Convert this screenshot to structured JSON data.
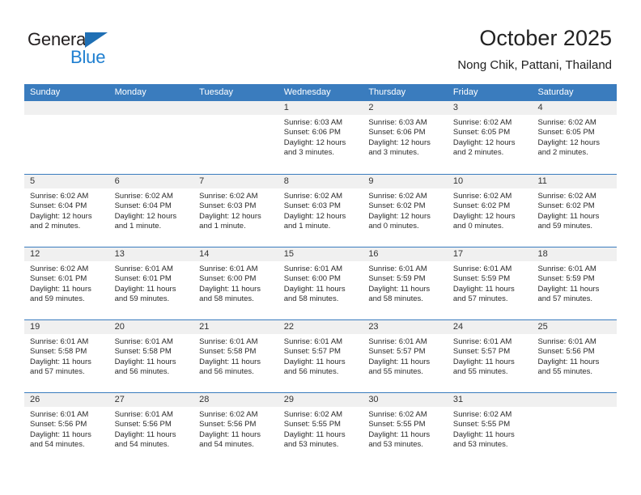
{
  "brand": {
    "name_part1": "General",
    "name_part2": "Blue",
    "triangle_color": "#1f6fb4",
    "blue_color": "#1f7fd0"
  },
  "header": {
    "title": "October 2025",
    "subtitle": "Nong Chik, Pattani, Thailand"
  },
  "theme": {
    "header_row_bg": "#3a7cbe",
    "header_row_text": "#ffffff",
    "daynum_bg": "#f0f0f0",
    "cell_bg": "#ffffff",
    "grid_line": "#3a7cbe"
  },
  "weekdays": [
    "Sunday",
    "Monday",
    "Tuesday",
    "Wednesday",
    "Thursday",
    "Friday",
    "Saturday"
  ],
  "labels": {
    "sunrise": "Sunrise:",
    "sunset": "Sunset:",
    "daylight": "Daylight:"
  },
  "weeks": [
    [
      {
        "day": "",
        "empty": true
      },
      {
        "day": "",
        "empty": true
      },
      {
        "day": "",
        "empty": true
      },
      {
        "day": "1",
        "sunrise": "Sunrise: 6:03 AM",
        "sunset": "Sunset: 6:06 PM",
        "daylight1": "Daylight: 12 hours",
        "daylight2": "and 3 minutes."
      },
      {
        "day": "2",
        "sunrise": "Sunrise: 6:03 AM",
        "sunset": "Sunset: 6:06 PM",
        "daylight1": "Daylight: 12 hours",
        "daylight2": "and 3 minutes."
      },
      {
        "day": "3",
        "sunrise": "Sunrise: 6:02 AM",
        "sunset": "Sunset: 6:05 PM",
        "daylight1": "Daylight: 12 hours",
        "daylight2": "and 2 minutes."
      },
      {
        "day": "4",
        "sunrise": "Sunrise: 6:02 AM",
        "sunset": "Sunset: 6:05 PM",
        "daylight1": "Daylight: 12 hours",
        "daylight2": "and 2 minutes."
      }
    ],
    [
      {
        "day": "5",
        "sunrise": "Sunrise: 6:02 AM",
        "sunset": "Sunset: 6:04 PM",
        "daylight1": "Daylight: 12 hours",
        "daylight2": "and 2 minutes."
      },
      {
        "day": "6",
        "sunrise": "Sunrise: 6:02 AM",
        "sunset": "Sunset: 6:04 PM",
        "daylight1": "Daylight: 12 hours",
        "daylight2": "and 1 minute."
      },
      {
        "day": "7",
        "sunrise": "Sunrise: 6:02 AM",
        "sunset": "Sunset: 6:03 PM",
        "daylight1": "Daylight: 12 hours",
        "daylight2": "and 1 minute."
      },
      {
        "day": "8",
        "sunrise": "Sunrise: 6:02 AM",
        "sunset": "Sunset: 6:03 PM",
        "daylight1": "Daylight: 12 hours",
        "daylight2": "and 1 minute."
      },
      {
        "day": "9",
        "sunrise": "Sunrise: 6:02 AM",
        "sunset": "Sunset: 6:02 PM",
        "daylight1": "Daylight: 12 hours",
        "daylight2": "and 0 minutes."
      },
      {
        "day": "10",
        "sunrise": "Sunrise: 6:02 AM",
        "sunset": "Sunset: 6:02 PM",
        "daylight1": "Daylight: 12 hours",
        "daylight2": "and 0 minutes."
      },
      {
        "day": "11",
        "sunrise": "Sunrise: 6:02 AM",
        "sunset": "Sunset: 6:02 PM",
        "daylight1": "Daylight: 11 hours",
        "daylight2": "and 59 minutes."
      }
    ],
    [
      {
        "day": "12",
        "sunrise": "Sunrise: 6:02 AM",
        "sunset": "Sunset: 6:01 PM",
        "daylight1": "Daylight: 11 hours",
        "daylight2": "and 59 minutes."
      },
      {
        "day": "13",
        "sunrise": "Sunrise: 6:01 AM",
        "sunset": "Sunset: 6:01 PM",
        "daylight1": "Daylight: 11 hours",
        "daylight2": "and 59 minutes."
      },
      {
        "day": "14",
        "sunrise": "Sunrise: 6:01 AM",
        "sunset": "Sunset: 6:00 PM",
        "daylight1": "Daylight: 11 hours",
        "daylight2": "and 58 minutes."
      },
      {
        "day": "15",
        "sunrise": "Sunrise: 6:01 AM",
        "sunset": "Sunset: 6:00 PM",
        "daylight1": "Daylight: 11 hours",
        "daylight2": "and 58 minutes."
      },
      {
        "day": "16",
        "sunrise": "Sunrise: 6:01 AM",
        "sunset": "Sunset: 5:59 PM",
        "daylight1": "Daylight: 11 hours",
        "daylight2": "and 58 minutes."
      },
      {
        "day": "17",
        "sunrise": "Sunrise: 6:01 AM",
        "sunset": "Sunset: 5:59 PM",
        "daylight1": "Daylight: 11 hours",
        "daylight2": "and 57 minutes."
      },
      {
        "day": "18",
        "sunrise": "Sunrise: 6:01 AM",
        "sunset": "Sunset: 5:59 PM",
        "daylight1": "Daylight: 11 hours",
        "daylight2": "and 57 minutes."
      }
    ],
    [
      {
        "day": "19",
        "sunrise": "Sunrise: 6:01 AM",
        "sunset": "Sunset: 5:58 PM",
        "daylight1": "Daylight: 11 hours",
        "daylight2": "and 57 minutes."
      },
      {
        "day": "20",
        "sunrise": "Sunrise: 6:01 AM",
        "sunset": "Sunset: 5:58 PM",
        "daylight1": "Daylight: 11 hours",
        "daylight2": "and 56 minutes."
      },
      {
        "day": "21",
        "sunrise": "Sunrise: 6:01 AM",
        "sunset": "Sunset: 5:58 PM",
        "daylight1": "Daylight: 11 hours",
        "daylight2": "and 56 minutes."
      },
      {
        "day": "22",
        "sunrise": "Sunrise: 6:01 AM",
        "sunset": "Sunset: 5:57 PM",
        "daylight1": "Daylight: 11 hours",
        "daylight2": "and 56 minutes."
      },
      {
        "day": "23",
        "sunrise": "Sunrise: 6:01 AM",
        "sunset": "Sunset: 5:57 PM",
        "daylight1": "Daylight: 11 hours",
        "daylight2": "and 55 minutes."
      },
      {
        "day": "24",
        "sunrise": "Sunrise: 6:01 AM",
        "sunset": "Sunset: 5:57 PM",
        "daylight1": "Daylight: 11 hours",
        "daylight2": "and 55 minutes."
      },
      {
        "day": "25",
        "sunrise": "Sunrise: 6:01 AM",
        "sunset": "Sunset: 5:56 PM",
        "daylight1": "Daylight: 11 hours",
        "daylight2": "and 55 minutes."
      }
    ],
    [
      {
        "day": "26",
        "sunrise": "Sunrise: 6:01 AM",
        "sunset": "Sunset: 5:56 PM",
        "daylight1": "Daylight: 11 hours",
        "daylight2": "and 54 minutes."
      },
      {
        "day": "27",
        "sunrise": "Sunrise: 6:01 AM",
        "sunset": "Sunset: 5:56 PM",
        "daylight1": "Daylight: 11 hours",
        "daylight2": "and 54 minutes."
      },
      {
        "day": "28",
        "sunrise": "Sunrise: 6:02 AM",
        "sunset": "Sunset: 5:56 PM",
        "daylight1": "Daylight: 11 hours",
        "daylight2": "and 54 minutes."
      },
      {
        "day": "29",
        "sunrise": "Sunrise: 6:02 AM",
        "sunset": "Sunset: 5:55 PM",
        "daylight1": "Daylight: 11 hours",
        "daylight2": "and 53 minutes."
      },
      {
        "day": "30",
        "sunrise": "Sunrise: 6:02 AM",
        "sunset": "Sunset: 5:55 PM",
        "daylight1": "Daylight: 11 hours",
        "daylight2": "and 53 minutes."
      },
      {
        "day": "31",
        "sunrise": "Sunrise: 6:02 AM",
        "sunset": "Sunset: 5:55 PM",
        "daylight1": "Daylight: 11 hours",
        "daylight2": "and 53 minutes."
      },
      {
        "day": "",
        "empty": true
      }
    ]
  ]
}
